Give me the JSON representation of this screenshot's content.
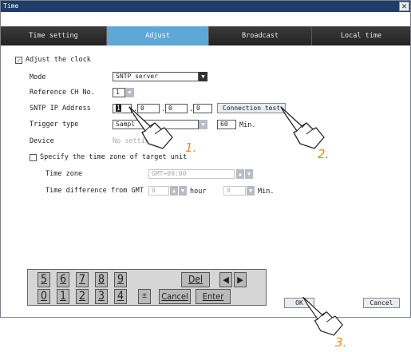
{
  "window": {
    "title": "Time",
    "close": "✕"
  },
  "tabs": [
    {
      "label": "Time setting",
      "active": false
    },
    {
      "label": "Adjust",
      "active": true
    },
    {
      "label": "Broadcast",
      "active": false
    },
    {
      "label": "Local time",
      "active": false
    }
  ],
  "adjust": {
    "checkbox_label": "Adjust the clock",
    "checked": true,
    "mode_label": "Mode",
    "mode_value": "SNTP server",
    "ref_label": "Reference CH No.",
    "ref_value": "1",
    "sntp_label": "SNTP IP Address",
    "ip": [
      "1",
      "0",
      "0",
      "0"
    ],
    "dot": ".",
    "connection_test": "Connection test",
    "trigger_label": "Trigger type",
    "trigger_value": "Sampl",
    "trigger_num": "60",
    "trigger_unit": "Min.",
    "device_label": "Device",
    "device_value": "No setting",
    "specify_label": "Specify the time zone of target unit",
    "specify_checked": false,
    "timezone_label": "Time zone",
    "timezone_value": "GMT+09:00",
    "timediff_label": "Time difference from GMT",
    "hour_value": "0",
    "hour_unit": "hour",
    "min_value": "0",
    "min_unit": "Min."
  },
  "keypad": {
    "row1": [
      "5",
      "6",
      "7",
      "8",
      "9"
    ],
    "row2": [
      "0",
      "1",
      "2",
      "3",
      "4"
    ],
    "del": "Del",
    "left": "◀",
    "right": "▶",
    "sign": "±",
    "cancel": "Cancel",
    "enter": "Enter"
  },
  "buttons": {
    "ok": "OK",
    "cancel": "Cancel"
  },
  "callouts": [
    "1.",
    "2.",
    "3."
  ],
  "colors": {
    "titlebar": "#1f3d66",
    "active_tab": "#5ea7d6",
    "callout": "#ef8a1a",
    "check": "#c0392b"
  }
}
